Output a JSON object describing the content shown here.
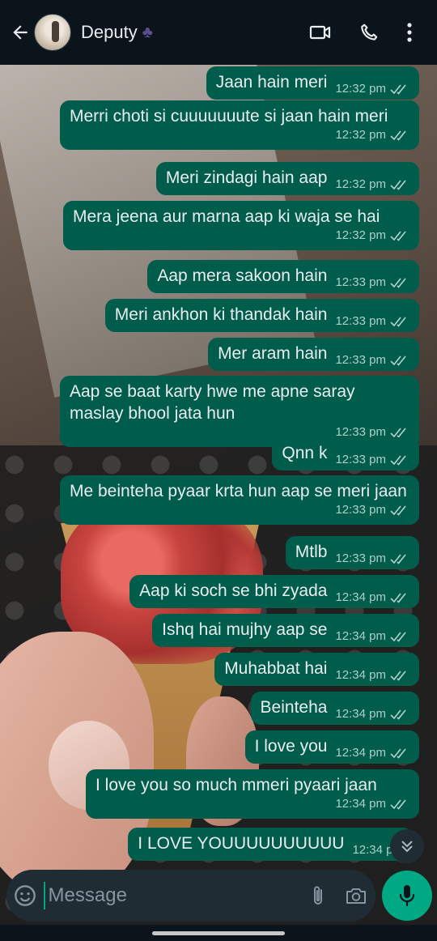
{
  "header": {
    "contact_name": "Deputy",
    "contact_emoji": "♣",
    "icons": [
      "back-arrow-icon",
      "video-call-icon",
      "voice-call-icon",
      "more-options-icon"
    ]
  },
  "messages": [
    {
      "text": "Jaan hain meri",
      "time": "12:32 pm",
      "status": "sent"
    },
    {
      "text": "Merri choti si cuuuuuuute si jaan hain meri",
      "time": "12:32 pm",
      "status": "sent"
    },
    {
      "text": "Meri zindagi hain aap",
      "time": "12:32 pm",
      "status": "sent"
    },
    {
      "text": "Mera jeena aur marna aap ki waja se hai",
      "time": "12:32 pm",
      "status": "sent"
    },
    {
      "text": "Aap mera sakoon hain",
      "time": "12:33 pm",
      "status": "sent"
    },
    {
      "text": "Meri ankhon ki thandak hain",
      "time": "12:33 pm",
      "status": "sent"
    },
    {
      "text": "Mer aram hain",
      "time": "12:33 pm",
      "status": "sent"
    },
    {
      "text": "Aap se baat karty hwe me apne saray maslay bhool jata hun",
      "time": "12:33 pm",
      "status": "sent"
    },
    {
      "text": "Qnn k",
      "time": "12:33 pm",
      "status": "sent"
    },
    {
      "text": "Me beinteha pyaar krta hun aap se meri jaan",
      "time": "12:33 pm",
      "status": "sent"
    },
    {
      "text": "Mtlb",
      "time": "12:33 pm",
      "status": "sent"
    },
    {
      "text": "Aap ki soch se bhi zyada",
      "time": "12:34 pm",
      "status": "sent"
    },
    {
      "text": "Ishq hai mujhy aap se",
      "time": "12:34 pm",
      "status": "sent"
    },
    {
      "text": "Muhabbat hai",
      "time": "12:34 pm",
      "status": "sent"
    },
    {
      "text": "Beinteha",
      "time": "12:34 pm",
      "status": "sent"
    },
    {
      "text": "I love you",
      "time": "12:34 pm",
      "status": "sent"
    },
    {
      "text": "I love you so much mmeri pyaari jaan",
      "time": "12:34 pm",
      "status": "sent"
    },
    {
      "text": "I LOVE YOUUUUUUUUUU",
      "time": "12:34 pm",
      "status": "sent"
    }
  ],
  "composer": {
    "placeholder": "Message",
    "icons": [
      "emoji-icon",
      "attach-icon",
      "camera-icon",
      "mic-icon"
    ]
  },
  "colors": {
    "header_bg": "#0b141a",
    "outgoing_bubble": "#005c4b",
    "accent": "#00a884",
    "composer_bg": "#1f2c34"
  }
}
